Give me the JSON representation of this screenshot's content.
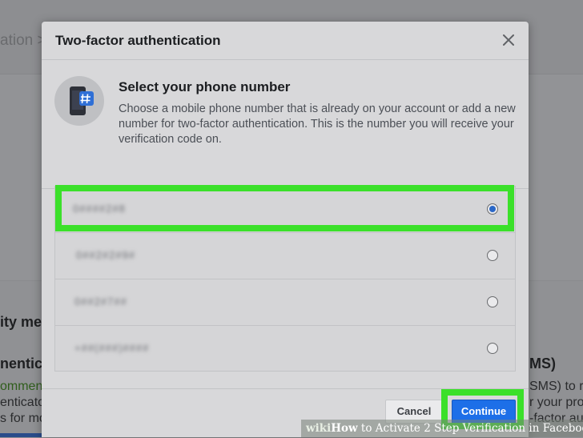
{
  "background": {
    "breadcrumb": "ation >",
    "section_heading": "ity me",
    "auth_heading": "nenticat",
    "recommend_text": "ommend",
    "line2": "enticato",
    "line3": "s for mo",
    "right_heading": "MS)",
    "right_line1": "SMS) to re",
    "right_line2": "r your pro",
    "right_line3": "-factor au"
  },
  "modal": {
    "title": "Two-factor authentication",
    "intro_title": "Select your phone number",
    "intro_desc": "Choose a mobile phone number that is already on your account or add a new number for two-factor authentication. This is the number you will receive your verification code on.",
    "phone_options": [
      {
        "label": "0####2#8",
        "selected": true
      },
      {
        "label": "0##2#2#9#",
        "selected": false
      },
      {
        "label": "0##2#7##",
        "selected": false
      },
      {
        "label": "+##(###)####",
        "selected": false
      }
    ],
    "cancel_label": "Cancel",
    "continue_label": "Continue"
  },
  "watermark": {
    "wiki": "wiki",
    "how": "How",
    "text": " to Activate 2 Step Verification in Facebook"
  },
  "colors": {
    "highlight": "#3be02a",
    "continue_blue": "#1d6fe8",
    "radio_blue": "#2a67c7"
  }
}
